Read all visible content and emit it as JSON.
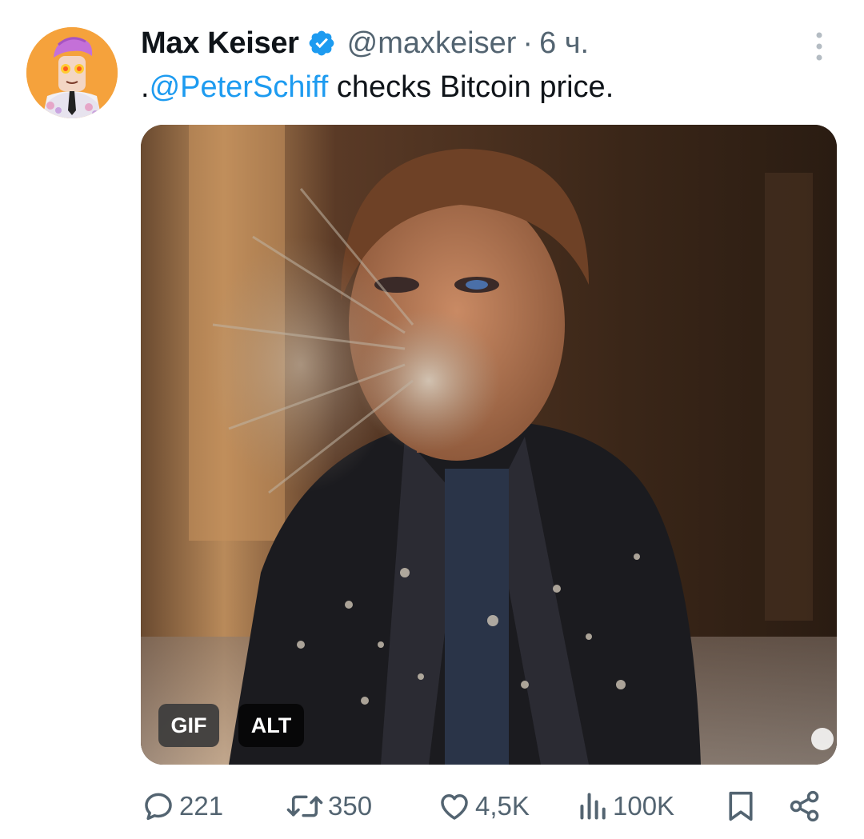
{
  "tweet": {
    "author": {
      "display_name": "Max Keiser",
      "handle": "@maxkeiser",
      "verified": true,
      "avatar_icon": "cartoon-avatar"
    },
    "separator": "·",
    "time": "6 ч.",
    "text": {
      "prefix": ".",
      "mention": "@PeterSchiff",
      "rest": " checks Bitcoin price."
    },
    "media": {
      "type": "gif",
      "badges": {
        "gif": "GIF",
        "alt": "ALT"
      }
    },
    "actions": {
      "replies": "221",
      "reposts": "350",
      "likes": "4,5K",
      "views": "100K"
    }
  },
  "colors": {
    "accent": "#1d9bf0",
    "muted": "#536471",
    "text": "#0f1419"
  },
  "icons": [
    "more-icon",
    "verified-icon",
    "reply-icon",
    "repost-icon",
    "like-icon",
    "views-icon",
    "bookmark-icon",
    "share-icon"
  ]
}
